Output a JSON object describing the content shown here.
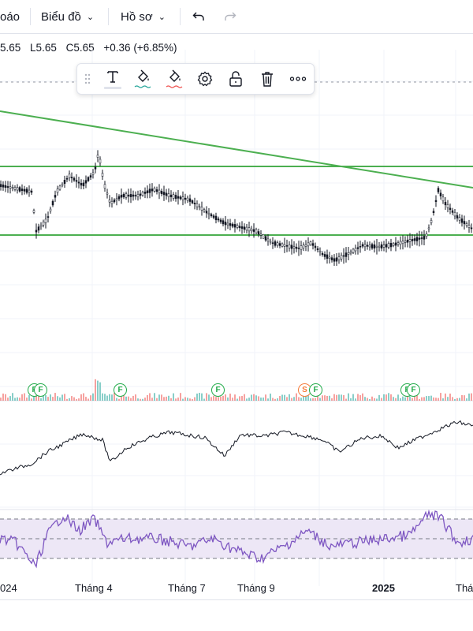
{
  "topbar": {
    "left_fragment": "oáo",
    "chart_menu": "Biểu đồ",
    "profile_menu": "Hồ sơ",
    "undo_icon": "undo-icon",
    "redo_icon": "redo-icon"
  },
  "ohlc": {
    "open_fragment": "5.65",
    "low": "L5.65",
    "close": "C5.65",
    "change": "+0.36 (+6.85%)"
  },
  "drawing_toolbar": {
    "icons": [
      "drag-handle-icon",
      "text-icon",
      "line-color-icon",
      "fill-color-icon",
      "settings-icon",
      "unlock-icon",
      "delete-icon",
      "more-icon"
    ]
  },
  "events": {
    "dividend_label": "F",
    "split_label": "S"
  },
  "x_axis": {
    "labels": [
      "024",
      "Tháng 4",
      "Tháng 7",
      "Tháng 9",
      "2025",
      "Thán"
    ]
  },
  "colors": {
    "up": "#26a69a",
    "down": "#ef5350",
    "trendline": "#4caf50",
    "rsi": "#7e57c2",
    "rsi_band": "#ede7f6",
    "text": "#131722",
    "grid": "#f0f3fa"
  }
}
